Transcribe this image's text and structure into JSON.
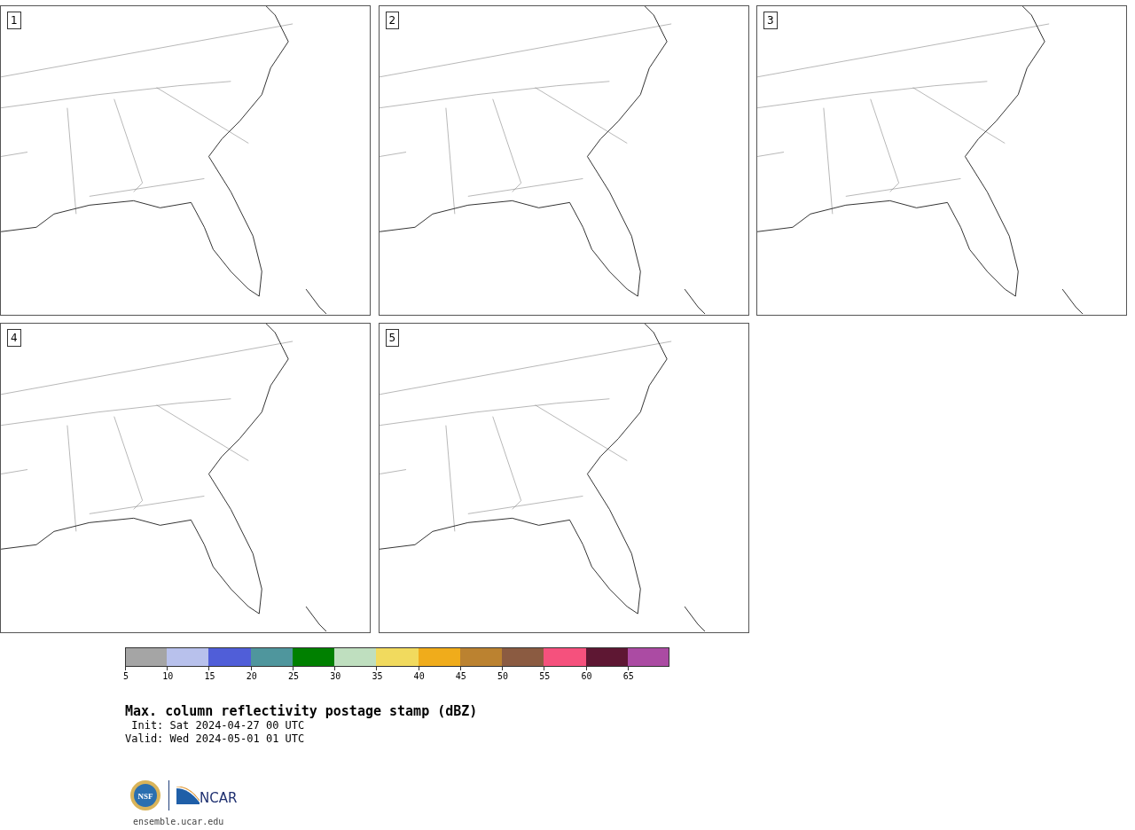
{
  "panels": [
    {
      "label": "1"
    },
    {
      "label": "2"
    },
    {
      "label": "3"
    },
    {
      "label": "4"
    },
    {
      "label": "5"
    }
  ],
  "colorbar": {
    "segments": [
      {
        "color": "#a5a5a5",
        "tick": "5"
      },
      {
        "color": "#b8c1ec",
        "tick": "10"
      },
      {
        "color": "#505ed8",
        "tick": "15"
      },
      {
        "color": "#4f969d",
        "tick": "20"
      },
      {
        "color": "#008000",
        "tick": "25"
      },
      {
        "color": "#bfdfbf",
        "tick": "30"
      },
      {
        "color": "#f1da5e",
        "tick": "35"
      },
      {
        "color": "#f0ac1b",
        "tick": "40"
      },
      {
        "color": "#bb8230",
        "tick": "45"
      },
      {
        "color": "#8b5b41",
        "tick": "50"
      },
      {
        "color": "#f5517d",
        "tick": "55"
      },
      {
        "color": "#5e1733",
        "tick": "60"
      },
      {
        "color": "#ab4ba3",
        "tick": "65"
      }
    ]
  },
  "title": "Max. column reflectivity postage stamp (dBZ)",
  "init": " Init: Sat 2024-04-27 00 UTC",
  "valid": "Valid: Wed 2024-05-01 01 UTC",
  "logos": {
    "nsf": "NSF",
    "ncar": "NCAR"
  },
  "footer_link": "ensemble.ucar.edu"
}
